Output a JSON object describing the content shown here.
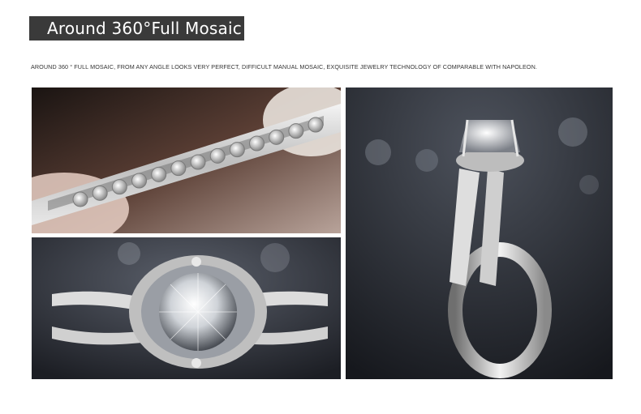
{
  "header": {
    "title": "Around 360°Full Mosaic",
    "subtitle": "AROUND 360 °   FULL MOSAIC, FROM ANY ANGLE LOOKS VERY PERFECT, DIFFICULT MANUAL MOSAIC, EXQUISITE JEWELRY TECHNOLOGY OF COMPARABLE WITH NAPOLEON."
  },
  "colors": {
    "banner_bg": "#3a3a3a",
    "banner_text": "#ffffff",
    "subtitle_text": "#333333",
    "photo_bg": "#2b2d33"
  },
  "images": [
    {
      "id": "photo-top-left",
      "content": "close-up of ring band with channel-set diamonds held by tweezers"
    },
    {
      "id": "photo-bottom-left",
      "content": "front view of ring with round center stone and pave halo"
    },
    {
      "id": "photo-right",
      "content": "side view of ring with split pave shank"
    }
  ]
}
